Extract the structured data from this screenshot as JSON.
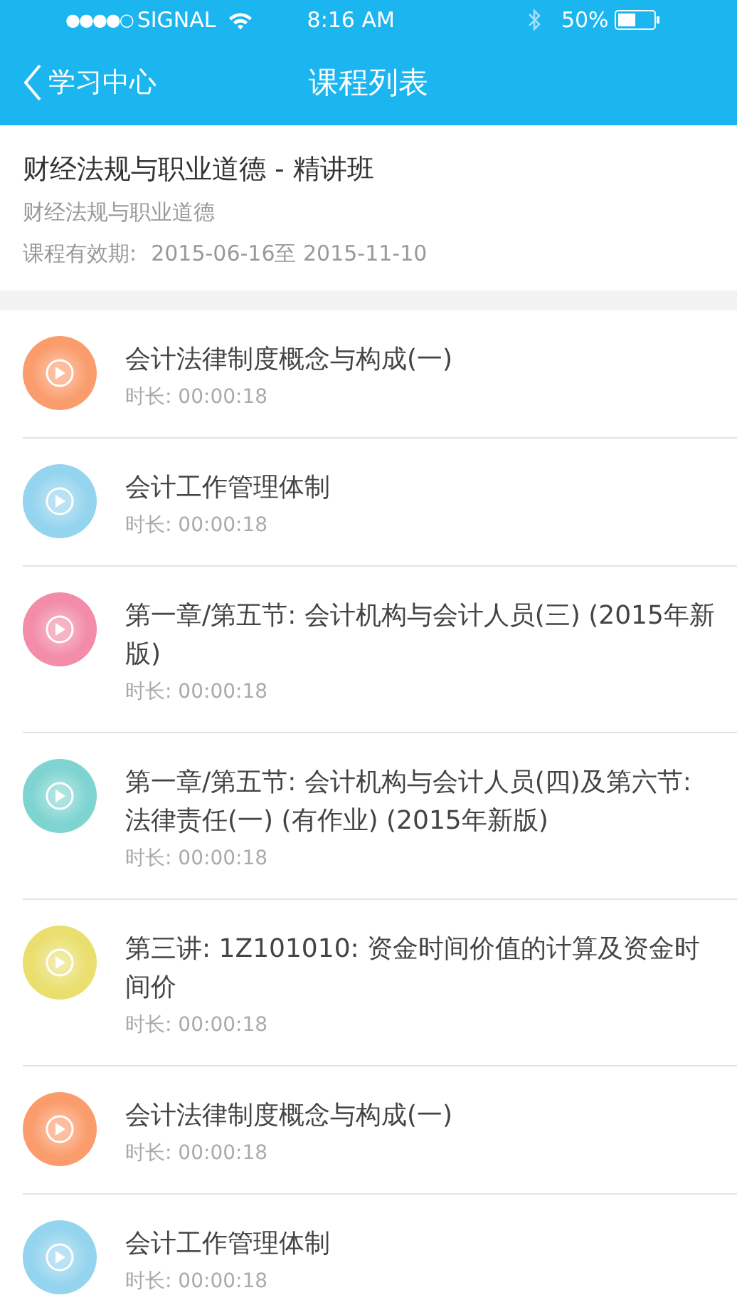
{
  "status_bar": {
    "signal": "●●●●○",
    "carrier": "SIGNAL",
    "time": "8:16 AM",
    "battery": "50%"
  },
  "nav": {
    "back": "学习中心",
    "title": "课程列表"
  },
  "course": {
    "title": "财经法规与职业道德 - 精讲班",
    "subtitle": "财经法规与职业道德",
    "validity_label": "课程有效期:",
    "validity": "2015-06-16至 2015-11-10"
  },
  "lessons": [
    {
      "title": "会计法律制度概念与构成(一)",
      "duration": "时长:  00:00:18",
      "color": "#fb9c6c"
    },
    {
      "title": "会计工作管理体制",
      "duration": "时长:  00:00:18",
      "color": "#94d4ee"
    },
    {
      "title": "第一章/第五节:  会计机构与会计人员(三) (2015年新版)",
      "duration": "时长:  00:00:18",
      "color": "#f28ca9"
    },
    {
      "title": "第一章/第五节:  会计机构与会计人员(四)及第六节:  法律责任(一) (有作业) (2015年新版)",
      "duration": "时长:  00:00:18",
      "color": "#7fd4d1"
    },
    {
      "title": "第三讲:  1Z101010:  资金时间价值的计算及资金时间价",
      "duration": "时长:  00:00:18",
      "color": "#eadf6e"
    },
    {
      "title": "会计法律制度概念与构成(一)",
      "duration": "时长:  00:00:18",
      "color": "#fb9c6c"
    },
    {
      "title": "会计工作管理体制",
      "duration": "时长:  00:00:18",
      "color": "#94d4ee"
    }
  ]
}
